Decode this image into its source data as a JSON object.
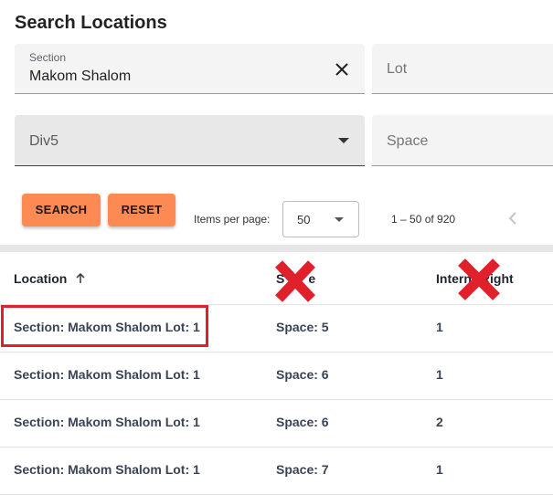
{
  "page_title": "Search Locations",
  "filters": {
    "section": {
      "label": "Section",
      "value": "Makom Shalom"
    },
    "lot": {
      "placeholder": "Lot"
    },
    "division": {
      "value": "Div5"
    },
    "space": {
      "placeholder": "Space"
    }
  },
  "buttons": {
    "search": "SEARCH",
    "reset": "RESET"
  },
  "paginator": {
    "items_per_page_label": "Items per page:",
    "items_per_page_value": "50",
    "range_label": "1 – 50 of 920"
  },
  "table": {
    "columns": [
      "Location",
      "Space",
      "Interment Right"
    ],
    "header_visible": {
      "space": "S",
      "space_end": "e",
      "interment_start": "Intern",
      "interment_end": "Right"
    },
    "rows": [
      {
        "location": "Section: Makom Shalom Lot: 1",
        "space": "Space: 5",
        "interment": "1"
      },
      {
        "location": "Section: Makom Shalom Lot: 1",
        "space": "Space: 6",
        "interment": "1"
      },
      {
        "location": "Section: Makom Shalom Lot: 1",
        "space": "Space: 6",
        "interment": "2"
      },
      {
        "location": "Section: Makom Shalom Lot: 1",
        "space": "Space: 7",
        "interment": "1"
      }
    ]
  },
  "colors": {
    "accent": "#fc8a52",
    "annotation": "#e0202a"
  },
  "icons": [
    "clear-icon",
    "dropdown-arrow-icon",
    "sort-arrow-up-icon",
    "chevron-left-icon",
    "red-x-mark-icon"
  ]
}
